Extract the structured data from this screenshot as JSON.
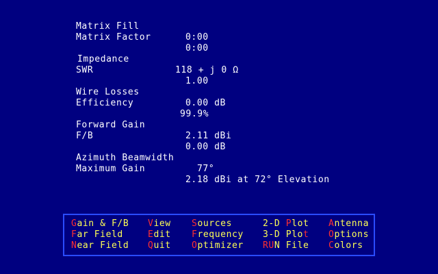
{
  "results": [
    {
      "label": "Matrix Fill",
      "value": "0:00"
    },
    {
      "label": "Matrix Factor",
      "value": "0:00"
    },
    {
      "label": "Impedance",
      "value": "118 + j 0 Ω"
    },
    {
      "label": "SWR",
      "value": "1.00"
    },
    {
      "label": "Wire Losses",
      "value": "0.00 dB"
    },
    {
      "label": "Efficiency",
      "value": "99.9%"
    },
    {
      "label": "Forward Gain",
      "value": "2.11 dBi"
    },
    {
      "label": "F/B",
      "value": "0.00 dB"
    },
    {
      "label": "Azimuth Beamwidth",
      "value": "77°"
    },
    {
      "label": "Maximum Gain",
      "value": "2.18 dBi at 72° Elevation"
    }
  ],
  "menu": [
    [
      {
        "hot": "G",
        "rest": "ain & F/B"
      },
      {
        "hot": "F",
        "rest": "ar Field"
      },
      {
        "hot": "N",
        "rest": "ear Field"
      }
    ],
    [
      {
        "hot": "V",
        "rest": "iew"
      },
      {
        "hot": "E",
        "rest": "dit"
      },
      {
        "hot": "Q",
        "rest": "uit"
      }
    ],
    [
      {
        "hot": "S",
        "rest": "ources"
      },
      {
        "hot": "F",
        "rest": "requency"
      },
      {
        "hot": "O",
        "rest": "ptimizer"
      }
    ],
    [
      {
        "pre": "2-D ",
        "hot": "P",
        "rest": "lot"
      },
      {
        "pre": "3-D Plo",
        "hot": "t",
        "rest": ""
      },
      {
        "hot": "RU",
        "rest": "N File"
      }
    ],
    [
      {
        "hot": "A",
        "rest": "ntenna"
      },
      {
        "hot": "O",
        "rest": "ptions"
      },
      {
        "hot": "C",
        "rest": "olors"
      }
    ]
  ],
  "colors": {
    "background": "#000080",
    "text": "#ffffff",
    "menu_text": "#ffff55",
    "hotkey": "#ff3030",
    "menu_border": "#2a4cff"
  }
}
